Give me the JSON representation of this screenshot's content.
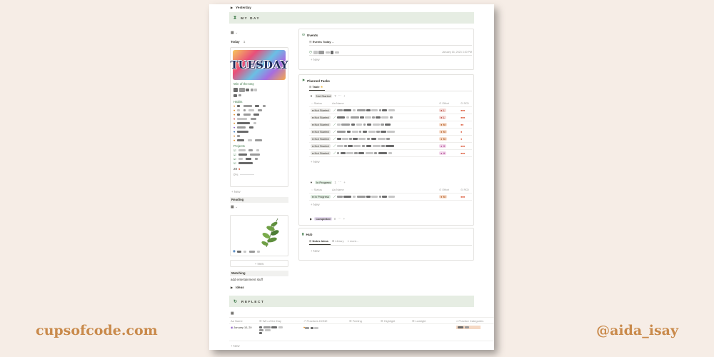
{
  "brand": {
    "left": "cupsofcode.com",
    "right": "@aida_isay"
  },
  "top": {
    "yesterday": "Yesterday",
    "my_day": "MY DAY",
    "ideas": "Ideas",
    "reflect": "REFLECT"
  },
  "left_col": {
    "today_label": "Today",
    "today_count": "1",
    "tuesday_text": "TUESDAY",
    "win_label": "Win of the Day",
    "habits_label": "Habits",
    "projects_label": "Projects",
    "count_text": "28",
    "percent": "0%",
    "new_label": "+ New",
    "reading_label": "Reading",
    "new2_label": "+ New",
    "watching_label": "Watching",
    "watching_text": "add entertainment stuff"
  },
  "events": {
    "title": "Events",
    "view": "Events Today",
    "date": "January 16, 2023 3:30 PM",
    "new_label": "+ New"
  },
  "tasks": {
    "title": "Planned Tasks",
    "tab": "Table",
    "groups": {
      "not_started": {
        "label": "Not Started",
        "count": "7"
      },
      "in_progress": {
        "label": "In Progress",
        "count": "1"
      },
      "completed": {
        "label": "Completed",
        "count": "0"
      }
    },
    "columns": {
      "status": "Status",
      "name": "Name",
      "effort": "Effort",
      "roi": "ROI"
    },
    "not_started_rows": [
      {
        "status": "Not Started",
        "effort": "L",
        "roi": "●●●"
      },
      {
        "status": "Not Started",
        "effort": "L",
        "roi": "●●●"
      },
      {
        "status": "Not Started",
        "effort": "M",
        "roi": "●●"
      },
      {
        "status": "Not Started",
        "effort": "M",
        "roi": "●"
      },
      {
        "status": "Not Started",
        "effort": "M",
        "roi": "●"
      },
      {
        "status": "Not Started",
        "effort": "H",
        "roi": "●●●"
      },
      {
        "status": "Not Started",
        "effort": "H",
        "roi": "●●●"
      }
    ],
    "in_progress_rows": [
      {
        "status": "In Progress",
        "effort": "M",
        "roi": "●●●"
      }
    ],
    "new_label": "+ New"
  },
  "hub": {
    "title": "Hub",
    "tabs": [
      "Notes Ideas",
      "Library",
      "1 more..."
    ],
    "new_label": "+ New"
  },
  "reflect_table": {
    "columns": [
      "Name",
      "Win of the Day",
      "Practices DONE",
      "Feeling",
      "Highlight",
      "Lowlight",
      "Practice Categories"
    ],
    "row_date": "January 10, 20",
    "new_label": "+ New"
  },
  "colors": {
    "accent_green": "#3f7a4a",
    "banner_bg": "#e6ede3",
    "brand_orange": "#c98a4b",
    "page_bg": "#f6ede6"
  }
}
